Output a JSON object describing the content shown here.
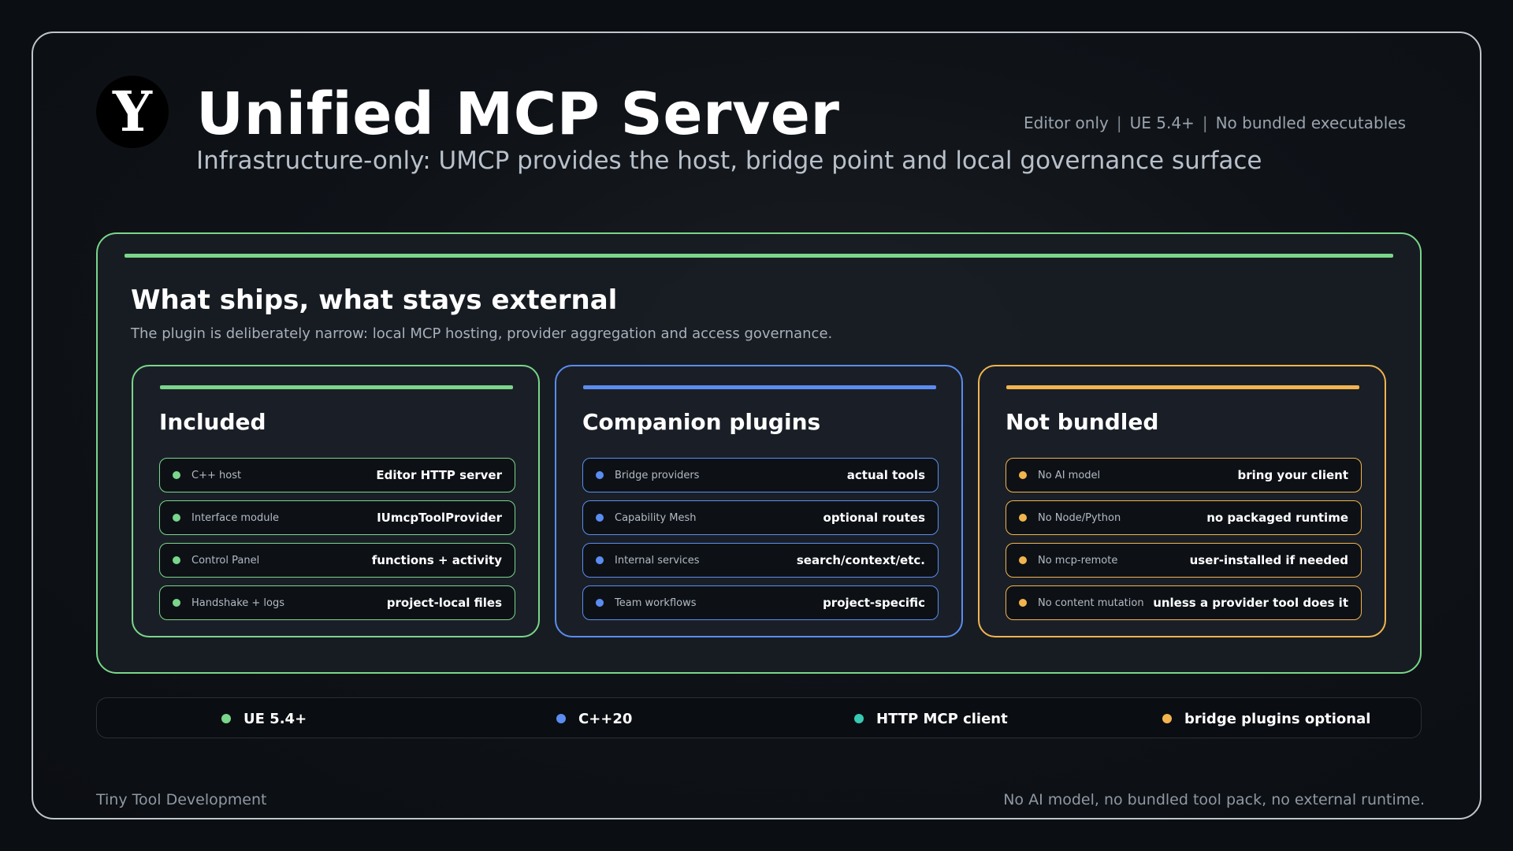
{
  "header": {
    "logo_letter": "Y",
    "title": "Unified MCP Server",
    "subtitle": "Infrastructure-only: UMCP provides the host, bridge point and local governance surface",
    "meta": [
      "Editor only",
      "UE 5.4+",
      "No bundled executables"
    ]
  },
  "panel": {
    "title": "What ships, what stays external",
    "subtitle": "The plugin is deliberately narrow: local MCP hosting, provider aggregation and access governance.",
    "cards": [
      {
        "title": "Included",
        "color": "#7ad68a",
        "rows": [
          {
            "label": "C++ host",
            "value": "Editor HTTP server"
          },
          {
            "label": "Interface module",
            "value": "IUmcpToolProvider"
          },
          {
            "label": "Control Panel",
            "value": "functions + activity"
          },
          {
            "label": "Handshake + logs",
            "value": "project-local files"
          }
        ]
      },
      {
        "title": "Companion plugins",
        "color": "#5b8cf0",
        "rows": [
          {
            "label": "Bridge providers",
            "value": "actual tools"
          },
          {
            "label": "Capability Mesh",
            "value": "optional routes"
          },
          {
            "label": "Internal services",
            "value": "search/context/etc."
          },
          {
            "label": "Team workflows",
            "value": "project-specific"
          }
        ]
      },
      {
        "title": "Not bundled",
        "color": "#f2b44e",
        "rows": [
          {
            "label": "No AI model",
            "value": "bring your client"
          },
          {
            "label": "No Node/Python",
            "value": "no packaged runtime"
          },
          {
            "label": "No mcp-remote",
            "value": "user-installed if needed"
          },
          {
            "label": "No content mutation",
            "value": "unless a provider tool does it"
          }
        ]
      }
    ]
  },
  "strip": [
    {
      "text": "UE 5.4+",
      "color": "#7ad68a"
    },
    {
      "text": "C++20",
      "color": "#5b8cf0"
    },
    {
      "text": "HTTP MCP client",
      "color": "#38c9b4"
    },
    {
      "text": "bridge plugins optional",
      "color": "#f2b44e"
    }
  ],
  "footer": {
    "left": "Tiny Tool Development",
    "right": "No AI model, no bundled tool pack, no external runtime."
  }
}
